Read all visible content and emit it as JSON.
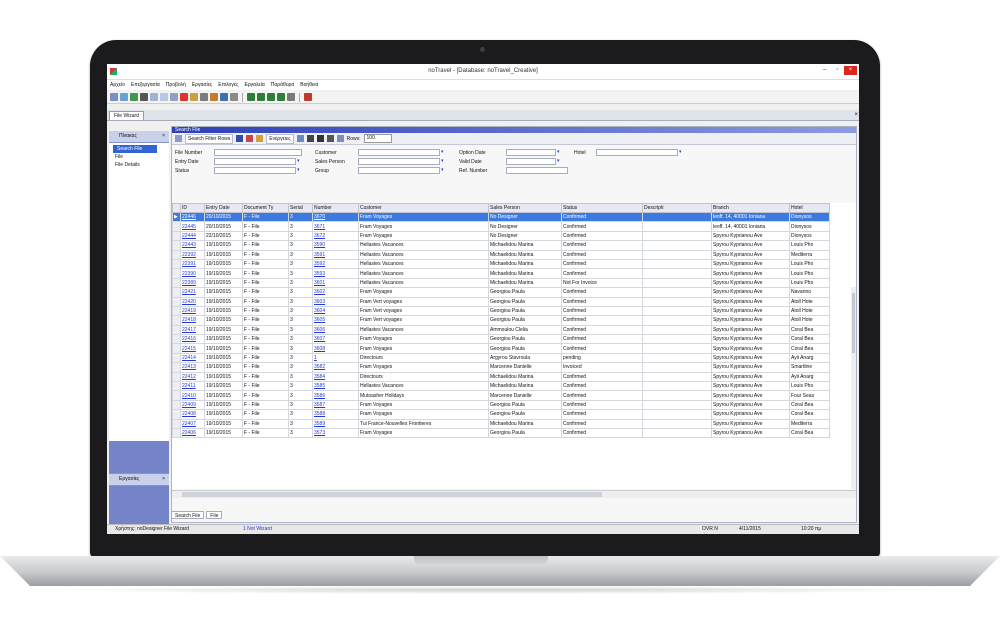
{
  "window": {
    "title": "noTravel - [Database: noTravel_Creative]",
    "minimize": "–",
    "restore": "▫",
    "close": "×"
  },
  "menu": [
    "Αρχείο",
    "Επεξεργασία",
    "Προβολή",
    "Εργασίες",
    "Επιλογές",
    "Εργαλεία",
    "Παράθυρα",
    "Βοήθεια"
  ],
  "doc_tab": "File Wizard",
  "left_pane": {
    "header": "Πίνακας",
    "tree": [
      "Search File",
      "File",
      "File Details"
    ],
    "footer": "Εργασίες",
    "close_glyph": "×"
  },
  "search": {
    "title": "Search File",
    "filter_button": "Search Filter Rows",
    "actions_button": "Ενέργειες",
    "rows_label": "Rows:",
    "rows_value": "100"
  },
  "filters": {
    "file_number": "File Number",
    "entry_date": "Entry Date",
    "status": "Status",
    "customer": "Customer",
    "sales_person": "Sales Person",
    "group": "Group",
    "option_date": "Option Date",
    "valid_date": "Valid Date",
    "ref_number": "Ref. Number",
    "hotel": "Hotel"
  },
  "grid": {
    "columns": [
      "ID",
      "Entry Date",
      "Document Ty",
      "Serial",
      "Number",
      "Customer",
      "Sales Person",
      "Status",
      "Descripti",
      "Branch",
      "Hotel"
    ],
    "rows": [
      [
        "22446",
        "20/10/2015",
        "F - File",
        "3",
        "3670",
        "Fram Voyages",
        "No Designer",
        "Confirmed",
        "",
        "leoff. 14, 40001 Ioniana",
        "Dionysos"
      ],
      [
        "22445",
        "20/10/2015",
        "F - File",
        "3",
        "3671",
        "Fram Voyages",
        "No Designer",
        "Confirmed",
        "",
        "leoff. 14, 40001 Ioniana",
        "Dionysos"
      ],
      [
        "22444",
        "22/10/2015",
        "F - File",
        "3",
        "3672",
        "Fram Voyages",
        "No Designer",
        "Confirmed",
        "",
        "Spyrou Kyprianou Ave",
        "Dionysos"
      ],
      [
        "22443",
        "19/10/2015",
        "F - File",
        "3",
        "3590",
        "Hellastes Vacances",
        "Michaelidou Marina",
        "Confirmed",
        "",
        "Spyrou Kyprianou Ave",
        "Louis Pho"
      ],
      [
        "22392",
        "19/10/2015",
        "F - File",
        "3",
        "3591",
        "Hellastes Vacances",
        "Michaelidou Marina",
        "Confirmed",
        "",
        "Spyrou Kyprianou Ave",
        "Mediterra"
      ],
      [
        "22391",
        "19/10/2015",
        "F - File",
        "3",
        "3592",
        "Hellastes Vacances",
        "Michaelidou Marina",
        "Confirmed",
        "",
        "Spyrou Kyprianou Ave",
        "Louis Pho"
      ],
      [
        "22390",
        "19/10/2015",
        "F - File",
        "3",
        "3593",
        "Hellastes Vacances",
        "Michaelidou Marina",
        "Confirmed",
        "",
        "Spyrou Kyprianou Ave",
        "Louis Pho"
      ],
      [
        "22389",
        "19/10/2015",
        "F - File",
        "3",
        "3601",
        "Hellastes Vacances",
        "Michaelidou Marina",
        "Not For Invoice",
        "",
        "Spyrou Kyprianou Ave",
        "Louis Pho"
      ],
      [
        "22421",
        "19/10/2015",
        "F - File",
        "3",
        "3602",
        "Fram Voyages",
        "Georgiou Paula",
        "Confirmed",
        "",
        "Spyrou Kyprianou Ave",
        "Navarino"
      ],
      [
        "22420",
        "19/10/2015",
        "F - File",
        "3",
        "3603",
        "Fram Vert voyages",
        "Georgiou Paula",
        "Confirmed",
        "",
        "Spyrou Kyprianou Ave",
        "Atoll Hote"
      ],
      [
        "22419",
        "19/10/2015",
        "F - File",
        "3",
        "3604",
        "Fram Vert voyages",
        "Georgiou Paula",
        "Confirmed",
        "",
        "Spyrou Kyprianou Ave",
        "Atoll Hote"
      ],
      [
        "22418",
        "19/10/2015",
        "F - File",
        "3",
        "3605",
        "Fram Vert voyages",
        "Georgiou Paula",
        "Confirmed",
        "",
        "Spyrou Kyprianou Ave",
        "Atoll Hote"
      ],
      [
        "22417",
        "19/10/2015",
        "F - File",
        "3",
        "3606",
        "Hellastes Vacances",
        "Ammoulou Clelia",
        "Confirmed",
        "",
        "Spyrou Kyprianou Ave",
        "Coral Bea"
      ],
      [
        "22416",
        "19/10/2015",
        "F - File",
        "3",
        "3607",
        "Fram Voyages",
        "Georgiou Paula",
        "Confirmed",
        "",
        "Spyrou Kyprianou Ave",
        "Coral Bea"
      ],
      [
        "22415",
        "19/10/2015",
        "F - File",
        "3",
        "3608",
        "Fram Voyages",
        "Georgiou Paula",
        "Confirmed",
        "",
        "Spyrou Kyprianou Ave",
        "Coral Bea"
      ],
      [
        "22414",
        "19/10/2015",
        "F - File",
        "3",
        "1",
        "Directours",
        "Argyrou Stavroula",
        "pending",
        "",
        "Spyrou Kyprianou Ave",
        "Ayii Anarg"
      ],
      [
        "22413",
        "19/10/2015",
        "F - File",
        "3",
        "3582",
        "Fram Voyages",
        "Marcenne Danielle",
        "Invoiced",
        "",
        "Spyrou Kyprianou Ave",
        "Smartline"
      ],
      [
        "22412",
        "19/10/2015",
        "F - File",
        "3",
        "3584",
        "Directours",
        "Michaelidou Marina",
        "Confirmed",
        "",
        "Spyrou Kyprianou Ave",
        "Ayii Anarg"
      ],
      [
        "22411",
        "19/10/2015",
        "F - File",
        "3",
        "3585",
        "Hellastes Vacances",
        "Michaelidou Marina",
        "Confirmed",
        "",
        "Spyrou Kyprianou Ave",
        "Louis Pho"
      ],
      [
        "22410",
        "19/10/2015",
        "F - File",
        "3",
        "3586",
        "Mutoasher Holidays",
        "Marcenne Danielle",
        "Confirmed",
        "",
        "Spyrou Kyprianou Ave",
        "Four Seas"
      ],
      [
        "22409",
        "19/10/2015",
        "F - File",
        "3",
        "3587",
        "Fram Voyages",
        "Georgiou Paula",
        "Confirmed",
        "",
        "Spyrou Kyprianou Ave",
        "Coral Bea"
      ],
      [
        "22408",
        "19/10/2015",
        "F - File",
        "3",
        "3588",
        "Fram Voyages",
        "Georgiou Paula",
        "Confirmed",
        "",
        "Spyrou Kyprianou Ave",
        "Coral Bea"
      ],
      [
        "22407",
        "19/10/2015",
        "F - File",
        "3",
        "3589",
        "Tui France-Nouvelles Frontieres",
        "Michaelidou Marina",
        "Confirmed",
        "",
        "Spyrou Kyprianou Ave",
        "Mediterra"
      ],
      [
        "22406",
        "19/10/2015",
        "F - File",
        "3",
        "3573",
        "Fram Voyages",
        "Georgiou Paula",
        "Confirmed",
        "",
        "Spyrou Kyprianou Ave",
        "Coral Bea"
      ]
    ]
  },
  "bottom_tabs": [
    "Search File",
    "File"
  ],
  "status": {
    "user": "Χρήστης: noDesigner   File Wizard",
    "link": "1 Not Wizard",
    "ovr": "OVR   N",
    "date": "4/11/2015",
    "time": "10:20 πμ"
  },
  "colors": {
    "accent": "#3d7ae0",
    "panel": "#7584c9",
    "link": "#2438d6"
  }
}
